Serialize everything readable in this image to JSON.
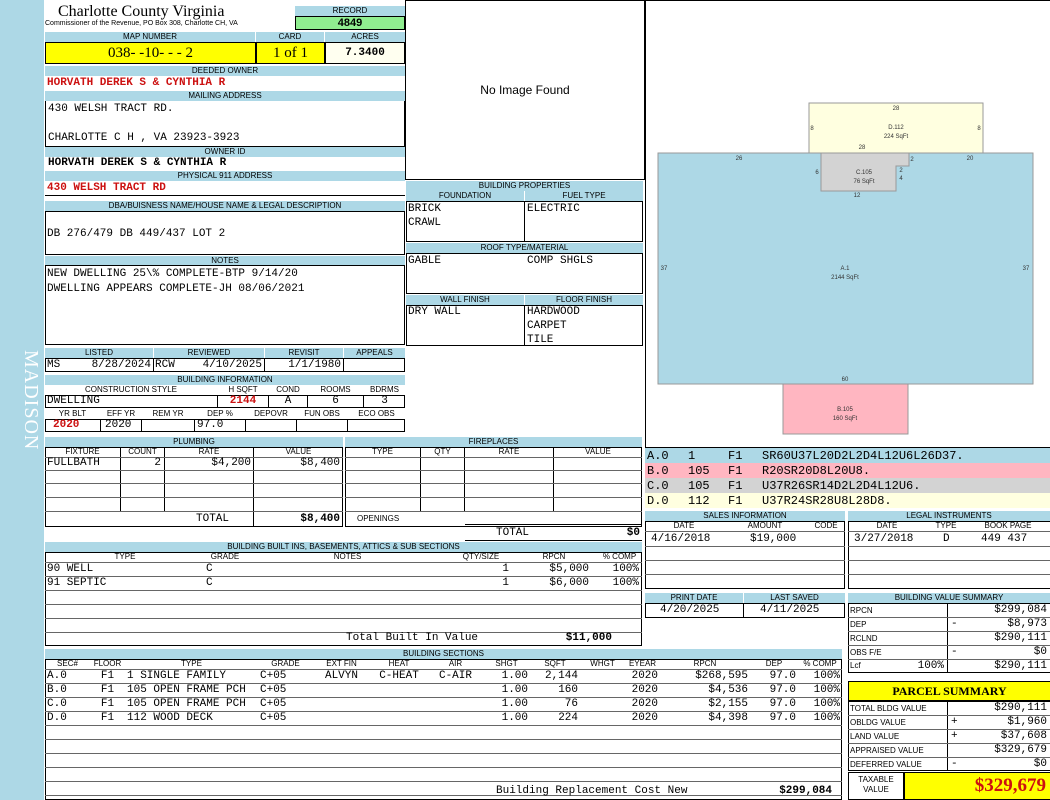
{
  "side_label": "MADISON",
  "header": {
    "county": "Charlotte County Virginia",
    "office": "Commissioner of the Revenue, PO Box 308, Charlotte CH, VA",
    "record_label": "RECORD",
    "record": "4849",
    "map_number_label": "MAP NUMBER",
    "map_number": "038- -10- - - 2",
    "card_label": "CARD",
    "card": "1 of 1",
    "acres_label": "ACRES",
    "acres": "7.3400"
  },
  "owner": {
    "deeded_label": "DEEDED OWNER",
    "deeded": "HORVATH DEREK S & CYNTHIA R",
    "mailing_label": "MAILING ADDRESS",
    "mailing_line1": "430 WELSH TRACT RD.",
    "mailing_line2": "CHARLOTTE C H , VA 23923-3923",
    "owner_id_label": "OWNER ID",
    "owner_id": "HORVATH DEREK S & CYNTHIA R",
    "physical_label": "PHYSICAL 911 ADDRESS",
    "physical": "430 WELSH TRACT RD"
  },
  "legal": {
    "label": "DBA/BUISNESS NAME/HOUSE NAME & LEGAL DESCRIPTION",
    "text": "DB 276/479 DB 449/437 LOT 2"
  },
  "notes": {
    "label": "NOTES",
    "line1": "NEW DWELLING 25\\% COMPLETE-BTP 9/14/20",
    "line2": "DWELLING APPEARS COMPLETE-JH 08/06/2021"
  },
  "image": {
    "text": "No Image Found"
  },
  "building_properties": {
    "label": "BUILDING PROPERTIES",
    "foundation_label": "FOUNDATION",
    "foundation": [
      "BRICK",
      "CRAWL"
    ],
    "fuel_label": "FUEL TYPE",
    "fuel": "ELECTRIC",
    "roof_label": "ROOF TYPE/MATERIAL",
    "roof_type": "GABLE",
    "roof_material": "COMP SHGLS",
    "wall_label": "WALL FINISH",
    "wall": "DRY WALL",
    "floor_label": "FLOOR FINISH",
    "floor": [
      "HARDWOOD",
      "CARPET",
      "TILE"
    ]
  },
  "review": {
    "listed_label": "LISTED",
    "listed_by": "MS",
    "listed_date": "8/28/2024",
    "reviewed_label": "REVIEWED",
    "reviewed_by": "RCW",
    "reviewed_date": "4/10/2025",
    "revisit_label": "REVISIT",
    "revisit": "1/1/1980",
    "appeals_label": "APPEALS",
    "appeals": ""
  },
  "building_info": {
    "label": "BUILDING INFORMATION",
    "style_label": "CONSTRUCTION STYLE",
    "style": "DWELLING",
    "hsqft_label": "H SQFT",
    "hsqft": "2144",
    "cond_label": "COND",
    "cond": "A",
    "rooms_label": "ROOMS",
    "rooms": "6",
    "bdrms_label": "BDRMS",
    "bdrms": "3",
    "yrblt_label": "YR BLT",
    "yrblt": "2020",
    "effyr_label": "EFF YR",
    "effyr": "2020",
    "remyr_label": "REM YR",
    "remyr": "",
    "dep_label": "DEP %",
    "dep": "97.0",
    "depovr_label": "DEPOVR",
    "depovr": "",
    "funobs_label": "FUN OBS",
    "funobs": "",
    "ecoobs_label": "ECO OBS",
    "ecoobs": ""
  },
  "plumbing": {
    "label": "PLUMBING",
    "col_fixture": "FIXTURE",
    "col_count": "COUNT",
    "col_rate": "RATE",
    "col_value": "VALUE",
    "rows": [
      {
        "fixture": "FULLBATH",
        "count": "2",
        "rate": "$4,200",
        "value": "$8,400"
      }
    ],
    "total_label": "TOTAL",
    "total": "$8,400"
  },
  "fireplaces": {
    "label": "FIREPLACES",
    "col_type": "TYPE",
    "col_qty": "QTY",
    "col_rate": "RATE",
    "col_value": "VALUE",
    "openings_label": "OPENINGS",
    "total_label": "TOTAL",
    "total": "$0"
  },
  "built_ins": {
    "label": "BUILDING BUILT INS, BASEMENTS, ATTICS & SUB SECTIONS",
    "col_type": "TYPE",
    "col_grade": "GRADE",
    "col_notes": "NOTES",
    "col_qty": "QTY/SIZE",
    "col_rpcn": "RPCN",
    "col_comp": "% COMP",
    "rows": [
      {
        "type": "90 WELL",
        "grade": "C",
        "qty": "1",
        "rpcn": "$5,000",
        "comp": "100%"
      },
      {
        "type": "91 SEPTIC",
        "grade": "C",
        "qty": "1",
        "rpcn": "$6,000",
        "comp": "100%"
      }
    ],
    "total_label": "Total Built In Value",
    "total": "$11,000"
  },
  "sections": {
    "label": "BUILDING SECTIONS",
    "cols": [
      "SEC#",
      "FLOOR",
      "TYPE",
      "GRADE",
      "EXT FIN",
      "HEAT",
      "AIR",
      "SHGT",
      "SQFT",
      "WHGT",
      "EYEAR",
      "RPCN",
      "DEP",
      "% COMP"
    ],
    "rows": [
      {
        "sec": "A.0",
        "floor": "F1",
        "type": "1 SINGLE FAMILY",
        "grade": "C+05",
        "ext": "ALVYN",
        "heat": "C-HEAT",
        "air": "C-AIR",
        "shgt": "1.00",
        "sqft": "2,144",
        "eyear": "2020",
        "rpcn": "$268,595",
        "dep": "97.0",
        "comp": "100%"
      },
      {
        "sec": "B.0",
        "floor": "F1",
        "type": "105 OPEN FRAME PCH",
        "grade": "C+05",
        "ext": "",
        "heat": "",
        "air": "",
        "shgt": "1.00",
        "sqft": "160",
        "eyear": "2020",
        "rpcn": "$4,536",
        "dep": "97.0",
        "comp": "100%"
      },
      {
        "sec": "C.0",
        "floor": "F1",
        "type": "105 OPEN FRAME PCH",
        "grade": "C+05",
        "ext": "",
        "heat": "",
        "air": "",
        "shgt": "1.00",
        "sqft": "76",
        "eyear": "2020",
        "rpcn": "$2,155",
        "dep": "97.0",
        "comp": "100%"
      },
      {
        "sec": "D.0",
        "floor": "F1",
        "type": "112 WOOD DECK",
        "grade": "C+05",
        "ext": "",
        "heat": "",
        "air": "",
        "shgt": "1.00",
        "sqft": "224",
        "eyear": "2020",
        "rpcn": "$4,398",
        "dep": "97.0",
        "comp": "100%"
      }
    ],
    "replacement_label": "Building Replacement Cost New",
    "replacement": "$299,084"
  },
  "sketch": {
    "d_label": "D.112",
    "d_area": "224 SqFt",
    "d_top": "28",
    "d_left": "8",
    "d_right": "8",
    "d_bottom": "28",
    "c_label": "C.105",
    "c_area": "76 SqFt",
    "c_left": "6",
    "c_right": "2",
    "c_right2": "4",
    "c_top": "2",
    "c_bottom": "12",
    "a_label": "A.1",
    "a_area": "2144 SqFt",
    "a_left": "37",
    "a_right": "37",
    "a_top_left": "26",
    "a_top_right": "20",
    "a_bottom": "60",
    "b_label": "B.105",
    "b_area": "160 SqFt"
  },
  "sketch_codes": [
    {
      "sec": "A.0",
      "num": "1",
      "floor": "F1",
      "code": "SR60U37L20D2L2D4L12U6L26D37.",
      "color": "#add8e6"
    },
    {
      "sec": "B.0",
      "num": "105",
      "floor": "F1",
      "code": "R20SR20D8L20U8.",
      "color": "#ffb6c1"
    },
    {
      "sec": "C.0",
      "num": "105",
      "floor": "F1",
      "code": "U37R26SR14D2L2D4L12U6.",
      "color": "#d3d3d3"
    },
    {
      "sec": "D.0",
      "num": "112",
      "floor": "F1",
      "code": "U37R24SR28U8L28D8.",
      "color": "#ffffe0"
    }
  ],
  "sales": {
    "label": "SALES INFORMATION",
    "col_date": "DATE",
    "col_amount": "AMOUNT",
    "col_code": "CODE",
    "rows": [
      {
        "date": "4/16/2018",
        "amount": "$19,000",
        "code": ""
      }
    ]
  },
  "instruments": {
    "label": "LEGAL INSTRUMENTS",
    "col_date": "DATE",
    "col_type": "TYPE",
    "col_book": "BOOK PAGE",
    "rows": [
      {
        "date": "3/27/2018",
        "type": "D",
        "book": "449 437"
      }
    ]
  },
  "dates": {
    "print_label": "PRINT DATE",
    "print": "4/20/2025",
    "saved_label": "LAST SAVED",
    "saved": "4/11/2025"
  },
  "value_summary": {
    "label": "BUILDING VALUE SUMMARY",
    "rpcn_label": "RPCN",
    "rpcn": "$299,084",
    "dep_label": "DEP",
    "dep_sign": "-",
    "dep": "$8,973",
    "rclnd_label": "RCLND",
    "rclnd": "$290,111",
    "obs_label": "OBS F/E",
    "obs_sign": "-",
    "obs": "$0",
    "lcf_label": "Lcf",
    "lcf_pct": "100%",
    "lcf": "$290,111"
  },
  "parcel": {
    "label": "PARCEL SUMMARY",
    "bldg_label": "TOTAL BLDG VALUE",
    "bldg": "$290,111",
    "obldg_label": "OBLDG VALUE",
    "obldg_sign": "+",
    "obldg": "$1,960",
    "land_label": "LAND VALUE",
    "land_sign": "+",
    "land": "$37,608",
    "appraised_label": "APPRAISED VALUE",
    "appraised": "$329,679",
    "deferred_label": "DEFERRED VALUE",
    "deferred_sign": "-",
    "deferred": "$0",
    "taxable_label1": "TAXABLE",
    "taxable_label2": "VALUE",
    "taxable": "$329,679"
  }
}
